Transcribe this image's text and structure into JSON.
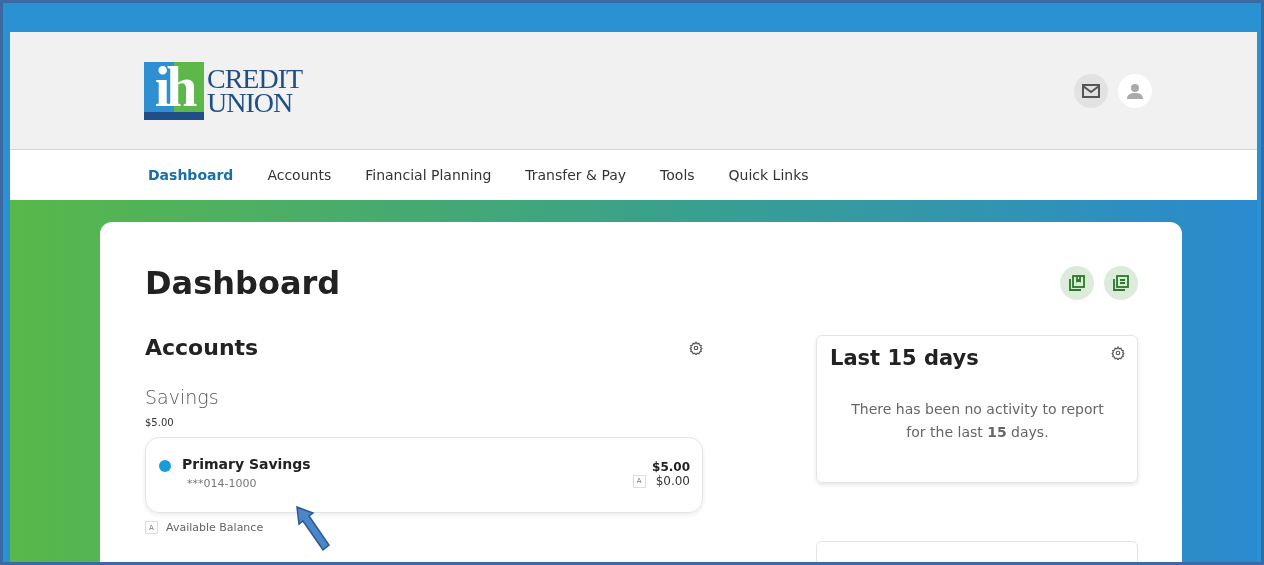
{
  "logo": {
    "mark": "ih",
    "lines": [
      "CREDIT",
      "UNION"
    ]
  },
  "nav": [
    {
      "label": "Dashboard",
      "selected": true
    },
    {
      "label": "Accounts",
      "selected": false
    },
    {
      "label": "Financial Planning",
      "selected": false
    },
    {
      "label": "Transfer & Pay",
      "selected": false
    },
    {
      "label": "Tools",
      "selected": false
    },
    {
      "label": "Quick Links",
      "selected": false
    }
  ],
  "page_title": "Dashboard",
  "accounts": {
    "title": "Accounts",
    "groups": [
      {
        "name": "Savings",
        "total": "$5.00",
        "items": [
          {
            "name": "Primary Savings",
            "number": "***014-1000",
            "color": "#1a9ad6",
            "balance": "$5.00",
            "available_mark": "A",
            "available": "$0.00"
          }
        ]
      }
    ],
    "legend": {
      "mark": "A",
      "label": "Available Balance"
    }
  },
  "activity": {
    "title": "Last 15 days",
    "message": "There has been no activity to report for the last **15** days."
  }
}
